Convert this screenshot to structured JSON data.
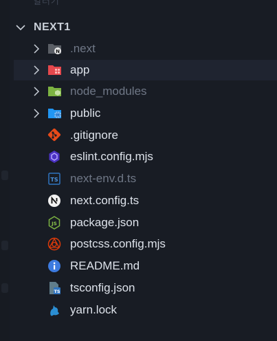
{
  "explorer": {
    "top_partial_text": "열러기",
    "root_folder": "NEXT1",
    "items": [
      {
        "label": ".next",
        "kind": "folder",
        "icon": "next-folder-icon",
        "dim": true
      },
      {
        "label": "app",
        "kind": "folder",
        "icon": "app-folder-icon",
        "dim": false,
        "selected": true
      },
      {
        "label": "node_modules",
        "kind": "folder",
        "icon": "node-modules-folder-icon",
        "dim": true
      },
      {
        "label": "public",
        "kind": "folder",
        "icon": "public-folder-icon",
        "dim": false
      },
      {
        "label": ".gitignore",
        "kind": "file",
        "icon": "git-icon",
        "dim": false
      },
      {
        "label": "eslint.config.mjs",
        "kind": "file",
        "icon": "eslint-icon",
        "dim": false
      },
      {
        "label": "next-env.d.ts",
        "kind": "file",
        "icon": "typescript-def-icon",
        "dim": true
      },
      {
        "label": "next.config.ts",
        "kind": "file",
        "icon": "nextjs-icon",
        "dim": false
      },
      {
        "label": "package.json",
        "kind": "file",
        "icon": "nodejs-icon",
        "dim": false
      },
      {
        "label": "postcss.config.mjs",
        "kind": "file",
        "icon": "postcss-icon",
        "dim": false
      },
      {
        "label": "README.md",
        "kind": "file",
        "icon": "info-icon",
        "dim": false
      },
      {
        "label": "tsconfig.json",
        "kind": "file",
        "icon": "tsconfig-icon",
        "dim": false
      },
      {
        "label": "yarn.lock",
        "kind": "file",
        "icon": "yarn-icon",
        "dim": false
      }
    ]
  },
  "colors": {
    "background": "#181c24",
    "selected_row": "#1f2430",
    "text": "#dde2ea",
    "text_dim": "#6f7786"
  }
}
